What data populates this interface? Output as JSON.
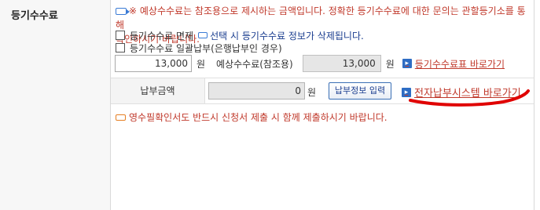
{
  "section_label": "등기수수료",
  "notice": {
    "line1": "※ 예상수수료는 참조용으로 제시하는 금액입니다. 정확한 등기수수료에 대한 문의는 관할등기소를 통해",
    "line2": "확인하시기 바랍니다."
  },
  "options": {
    "exempt_label": "등기수수료 면제",
    "exempt_note": "선택 시 등기수수료 정보가 삭제됩니다.",
    "bulk_label": "등기수수료 일괄납부(은행납부인 경우)"
  },
  "fee": {
    "amount_value": "13,000",
    "unit": "원",
    "estimated_label": "예상수수료(참조용)",
    "estimated_value": "13,000",
    "estimated_unit": "원",
    "fee_table_link": "등기수수료표 바로가기"
  },
  "payment": {
    "label": "납부금액",
    "amount_value": "0",
    "unit": "원",
    "enter_button": "납부정보 입력",
    "e_payment_link": "전자납부시스템 바로가기"
  },
  "footer_note": "영수필확인서도 반드시 신청서 제출 시 함께 제출하시기 바랍니다.",
  "colors": {
    "accent_red": "#c0392b",
    "link_blue": "#2e6dc4",
    "annotation_red": "#e00000"
  }
}
